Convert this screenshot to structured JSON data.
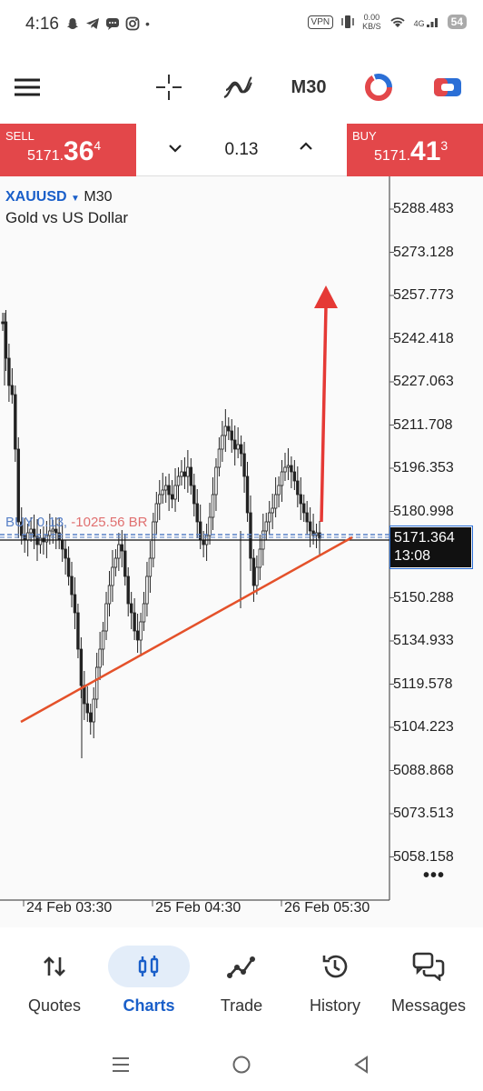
{
  "status_bar": {
    "time": "4:16",
    "icons": [
      "snapchat-icon",
      "telegram-icon",
      "chat-icon",
      "instagram-icon"
    ],
    "dot": "•",
    "vpn": "VPN",
    "speed_top": "0.00",
    "speed_bottom": "KB/S",
    "network": "4G",
    "battery": "54"
  },
  "toolbar": {
    "timeframe": "M30"
  },
  "trade": {
    "sell_label": "SELL",
    "sell_price_small": "5171.",
    "sell_price_big": "36",
    "sell_price_sup": "4",
    "lot": "0.13",
    "buy_label": "BUY",
    "buy_price_small": "5171.",
    "buy_price_big": "41",
    "buy_price_sup": "3"
  },
  "chart": {
    "symbol": "XAUUSD",
    "timeframe": "M30",
    "description": "Gold vs US Dollar",
    "order_label": "BUY 0.13, ",
    "order_pl": "-1025.56 BR",
    "current_price": "5171.364",
    "countdown": "13:08",
    "price_ticks": [
      "5288.483",
      "5273.128",
      "5257.773",
      "5242.418",
      "5227.063",
      "5211.708",
      "5196.353",
      "5180.998",
      "5150.288",
      "5134.933",
      "5119.578",
      "5104.223",
      "5088.868",
      "5073.513",
      "5058.158"
    ],
    "time_labels": [
      "24 Feb 03:30",
      "25 Feb 04:30",
      "26 Feb 05:30"
    ],
    "more": "•••",
    "colors": {
      "sell_buy": "#e3474a",
      "symbol": "#1a5fc9",
      "trendline": "#e4512a",
      "arrow": "#e53935",
      "order_line": "#5a82c8"
    }
  },
  "nav": {
    "items": [
      {
        "label": "Quotes",
        "icon": "quotes-icon"
      },
      {
        "label": "Charts",
        "icon": "charts-icon"
      },
      {
        "label": "Trade",
        "icon": "trade-icon"
      },
      {
        "label": "History",
        "icon": "history-icon"
      },
      {
        "label": "Messages",
        "icon": "messages-icon"
      }
    ],
    "active": "Charts"
  }
}
